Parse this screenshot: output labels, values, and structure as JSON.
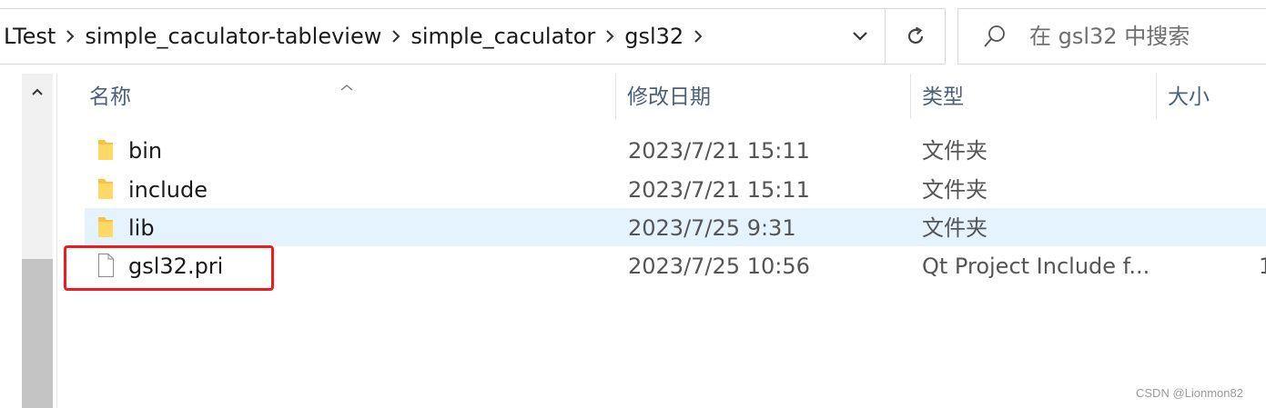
{
  "address_bar": {
    "breadcrumbs": [
      {
        "label": "LTest"
      },
      {
        "label": "simple_caculator-tableview"
      },
      {
        "label": "simple_caculator"
      },
      {
        "label": "gsl32"
      }
    ]
  },
  "search": {
    "placeholder": "在 gsl32 中搜索",
    "value": ""
  },
  "columns": {
    "name": "名称",
    "date": "修改日期",
    "type": "类型",
    "size": "大小"
  },
  "files": [
    {
      "name": "bin",
      "date": "2023/7/21 15:11",
      "type": "文件夹",
      "size": "",
      "icon": "folder-icon",
      "selected": false
    },
    {
      "name": "include",
      "date": "2023/7/21 15:11",
      "type": "文件夹",
      "size": "",
      "icon": "folder-icon",
      "selected": false
    },
    {
      "name": "lib",
      "date": "2023/7/25 9:31",
      "type": "文件夹",
      "size": "",
      "icon": "folder-icon",
      "selected": true
    },
    {
      "name": "gsl32.pri",
      "date": "2023/7/25 10:56",
      "type": "Qt Project Include f...",
      "size": "1",
      "icon": "file-icon",
      "selected": false
    }
  ],
  "annotation": {
    "highlighted_item": "gsl32.pri",
    "color": "#ee1c1c"
  },
  "watermark": "CSDN @Lionmon82",
  "colors": {
    "selection": "#e5f3ff",
    "header_text": "#4c607a",
    "folder": "#f6c343"
  }
}
